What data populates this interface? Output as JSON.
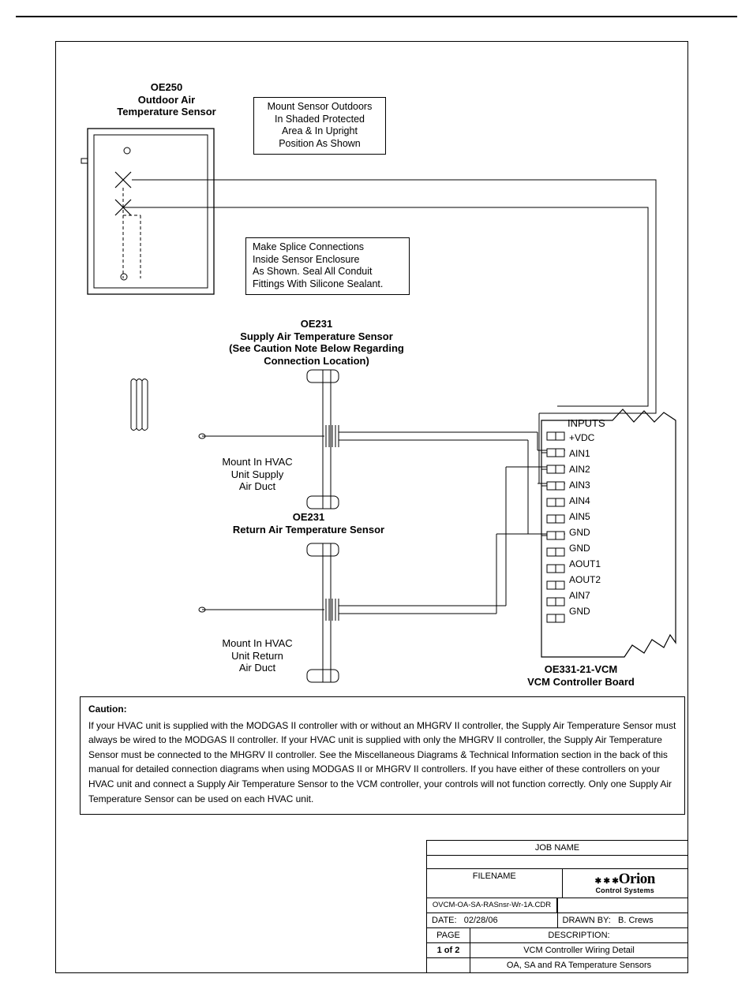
{
  "sensors": {
    "oe250_title": "OE250\nOutdoor Air\nTemperature Sensor",
    "oe231_supply_title": "OE231\nSupply Air Temperature Sensor\n(See Caution Note Below Regarding\nConnection Location)",
    "oe231_return_title": "OE231\nReturn Air Temperature Sensor",
    "mount_supply": "Mount In HVAC\nUnit Supply\nAir Duct",
    "mount_return": "Mount In HVAC\nUnit Return\nAir Duct"
  },
  "notes": {
    "mount_outdoors": "Mount Sensor Outdoors\nIn Shaded Protected\nArea & In Upright\nPosition As Shown",
    "splice": "Make Splice Connections\nInside Sensor Enclosure\nAs Shown. Seal All Conduit\nFittings With Silicone Sealant."
  },
  "controller": {
    "title": "OE331-21-VCM\nVCM Controller Board",
    "inputs_label": "INPUTS",
    "terminals": [
      "+VDC",
      "AIN1",
      "AIN2",
      "AIN3",
      "AIN4",
      "AIN5",
      "GND",
      "GND",
      "AOUT1",
      "AOUT2",
      "AIN7",
      "GND"
    ]
  },
  "caution": {
    "heading": "Caution:",
    "body": "If your HVAC unit is supplied with  the MODGAS II controller with or without an MHGRV II controller, the Supply Air Temperature Sensor must always be wired to the MODGAS II controller. If your HVAC unit is supplied with only the MHGRV II controller, the Supply Air Temperature Sensor must be connected to the MHGRV II controller. See the Miscellaneous Diagrams & Technical Information section in the back of this manual for detailed connection diagrams when using MODGAS II or MHGRV II controllers. If you have either of these controllers on your HVAC unit and connect a Supply Air Temperature Sensor to the VCM controller, your controls will not function correctly. Only one Supply Air Temperature Sensor can be used on each HVAC unit."
  },
  "titleblock": {
    "job_name_label": "JOB NAME",
    "filename_label": "FILENAME",
    "filename_value": "OVCM-OA-SA-RASnsr-Wr-1A.CDR",
    "date_label": "DATE:",
    "date_value": "02/28/06",
    "drawn_by_label": "DRAWN BY:",
    "drawn_by_value": "B. Crews",
    "page_label": "PAGE",
    "page_value": "1 of 2",
    "description_label": "DESCRIPTION:",
    "desc_line1": "VCM Controller Wiring Detail",
    "desc_line2": "OA, SA and RA Temperature Sensors",
    "logo_main": "Orion",
    "logo_sub": "Control Systems"
  }
}
